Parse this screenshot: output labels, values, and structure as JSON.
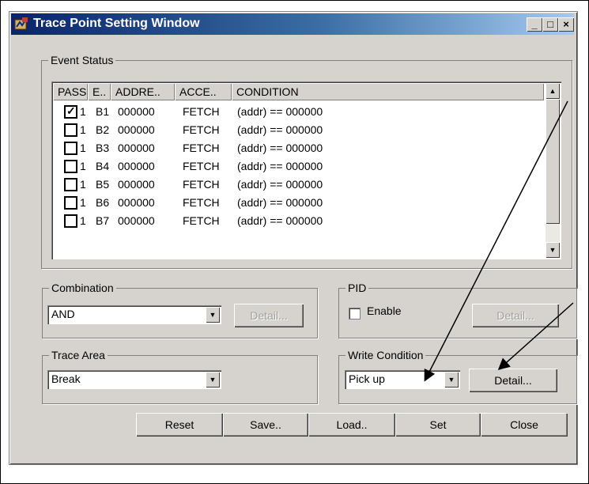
{
  "window": {
    "title": "Trace Point Setting Window",
    "min": "_",
    "max": "□",
    "close": "×"
  },
  "event_status": {
    "label": "Event Status",
    "columns": [
      "PASS",
      "E..",
      "ADDRE..",
      "ACCE..",
      "CONDITION"
    ],
    "rows": [
      {
        "checked": true,
        "pass": "1",
        "e": "B1",
        "addr": "000000",
        "access": "FETCH",
        "cond": "(addr) == 000000"
      },
      {
        "checked": false,
        "pass": "1",
        "e": "B2",
        "addr": "000000",
        "access": "FETCH",
        "cond": "(addr) == 000000"
      },
      {
        "checked": false,
        "pass": "1",
        "e": "B3",
        "addr": "000000",
        "access": "FETCH",
        "cond": "(addr) == 000000"
      },
      {
        "checked": false,
        "pass": "1",
        "e": "B4",
        "addr": "000000",
        "access": "FETCH",
        "cond": "(addr) == 000000"
      },
      {
        "checked": false,
        "pass": "1",
        "e": "B5",
        "addr": "000000",
        "access": "FETCH",
        "cond": "(addr) == 000000"
      },
      {
        "checked": false,
        "pass": "1",
        "e": "B6",
        "addr": "000000",
        "access": "FETCH",
        "cond": "(addr) == 000000"
      },
      {
        "checked": false,
        "pass": "1",
        "e": "B7",
        "addr": "000000",
        "access": "FETCH",
        "cond": "(addr) == 000000"
      }
    ],
    "check_mark": "✓",
    "scroll_up": "▲",
    "scroll_down": "▼"
  },
  "combination": {
    "label": "Combination",
    "value": "AND",
    "detail_label": "Detail..."
  },
  "pid": {
    "label": "PID",
    "enable_label": "Enable",
    "detail_label": "Detail..."
  },
  "trace_area": {
    "label": "Trace Area",
    "value": "Break"
  },
  "write_condition": {
    "label": "Write Condition",
    "value": "Pick up",
    "detail_label": "Detail..."
  },
  "combo_arrow": "▼",
  "buttons": {
    "reset": "Reset",
    "save": "Save..",
    "load": "Load..",
    "set": "Set",
    "close": "Close"
  },
  "colors": {
    "titlebar": "#0a246a",
    "face": "#d6d3ce"
  }
}
